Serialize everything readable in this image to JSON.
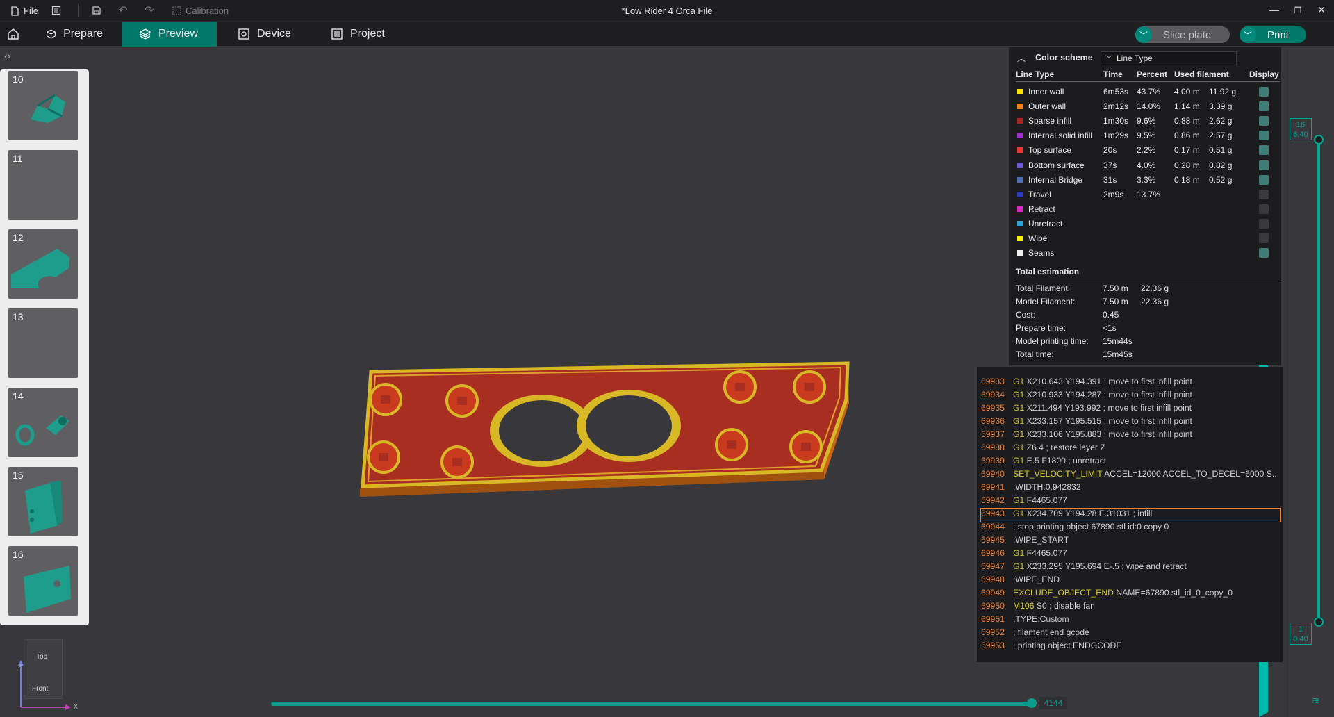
{
  "titlebar": {
    "file_label": "File",
    "calibration_label": "Calibration",
    "window_title": "*Low Rider 4 Orca File"
  },
  "nav": {
    "tabs": [
      {
        "label": "Prepare",
        "icon": "cube-icon"
      },
      {
        "label": "Preview",
        "icon": "layers-icon"
      },
      {
        "label": "Device",
        "icon": "device-icon"
      },
      {
        "label": "Project",
        "icon": "project-icon"
      }
    ],
    "slice_label": "Slice plate",
    "print_label": "Print"
  },
  "plates": [
    {
      "num": "10"
    },
    {
      "num": "11"
    },
    {
      "num": "12"
    },
    {
      "num": "13"
    },
    {
      "num": "14"
    },
    {
      "num": "15"
    },
    {
      "num": "16"
    }
  ],
  "gizmo": {
    "top": "Top",
    "front": "Front",
    "z": "Z",
    "x": "X"
  },
  "legend": {
    "title": "Color scheme",
    "scheme": "Line Type",
    "headers": {
      "type": "Line Type",
      "time": "Time",
      "percent": "Percent",
      "used": "Used filament",
      "display": "Display"
    },
    "rows": [
      {
        "name": "Inner wall",
        "color": "#ffe600",
        "time": "6m53s",
        "percent": "43.7%",
        "m": "4.00 m",
        "g": "11.92 g",
        "on": true
      },
      {
        "name": "Outer wall",
        "color": "#ff7f00",
        "time": "2m12s",
        "percent": "14.0%",
        "m": "1.14 m",
        "g": "3.39 g",
        "on": true
      },
      {
        "name": "Sparse infill",
        "color": "#b0231f",
        "time": "1m30s",
        "percent": "9.6%",
        "m": "0.88 m",
        "g": "2.62 g",
        "on": true
      },
      {
        "name": "Internal solid infill",
        "color": "#9933cc",
        "time": "1m29s",
        "percent": "9.5%",
        "m": "0.86 m",
        "g": "2.57 g",
        "on": true
      },
      {
        "name": "Top surface",
        "color": "#e43a2f",
        "time": "20s",
        "percent": "2.2%",
        "m": "0.17 m",
        "g": "0.51 g",
        "on": true
      },
      {
        "name": "Bottom surface",
        "color": "#6b58d6",
        "time": "37s",
        "percent": "4.0%",
        "m": "0.28 m",
        "g": "0.82 g",
        "on": true
      },
      {
        "name": "Internal Bridge",
        "color": "#4d6fb8",
        "time": "31s",
        "percent": "3.3%",
        "m": "0.18 m",
        "g": "0.52 g",
        "on": true
      },
      {
        "name": "Travel",
        "color": "#2b3ebf",
        "time": "2m9s",
        "percent": "13.7%",
        "m": "",
        "g": "",
        "on": false
      },
      {
        "name": "Retract",
        "color": "#d926d0",
        "time": "",
        "percent": "",
        "m": "",
        "g": "",
        "on": false
      },
      {
        "name": "Unretract",
        "color": "#29a6d9",
        "time": "",
        "percent": "",
        "m": "",
        "g": "",
        "on": false
      },
      {
        "name": "Wipe",
        "color": "#f2f200",
        "time": "",
        "percent": "",
        "m": "",
        "g": "",
        "on": false
      },
      {
        "name": "Seams",
        "color": "#f0f0f0",
        "time": "",
        "percent": "",
        "m": "",
        "g": "",
        "on": true
      }
    ],
    "total_title": "Total estimation",
    "totals": [
      {
        "label": "Total Filament:",
        "a": "7.50 m",
        "b": "22.36 g"
      },
      {
        "label": "Model Filament:",
        "a": "7.50 m",
        "b": "22.36 g"
      },
      {
        "label": "Cost:",
        "a": "0.45",
        "b": ""
      },
      {
        "label": "Prepare time:",
        "a": "<1s",
        "b": ""
      },
      {
        "label": "Model printing time:",
        "a": "15m44s",
        "b": ""
      },
      {
        "label": "Total time:",
        "a": "15m45s",
        "b": ""
      }
    ]
  },
  "gcode": [
    {
      "n": "69933",
      "c": "G1",
      "r": " X210.643 Y194.391 ; move to first infill point"
    },
    {
      "n": "69934",
      "c": "G1",
      "r": " X210.933 Y194.287 ; move to first infill point"
    },
    {
      "n": "69935",
      "c": "G1",
      "r": " X211.494 Y193.992 ; move to first infill point"
    },
    {
      "n": "69936",
      "c": "G1",
      "r": " X233.157 Y195.515 ; move to first infill point"
    },
    {
      "n": "69937",
      "c": "G1",
      "r": " X233.106 Y195.883 ; move to first infill point"
    },
    {
      "n": "69938",
      "c": "G1",
      "r": " Z6.4 ; restore layer Z"
    },
    {
      "n": "69939",
      "c": "G1",
      "r": " E.5 F1800 ; unretract"
    },
    {
      "n": "69940",
      "c": "SET_VELOCITY_LIMIT",
      "r": " ACCEL=12000 ACCEL_TO_DECEL=6000 S..."
    },
    {
      "n": "69941",
      "c": "",
      "r": ";WIDTH:0.942832"
    },
    {
      "n": "69942",
      "c": "G1",
      "r": " F4465.077"
    },
    {
      "n": "69943",
      "c": "G1",
      "r": " X234.709 Y194.28 E.31031 ; infill"
    },
    {
      "n": "69944",
      "c": "",
      "r": "; stop printing object 67890.stl id:0 copy 0"
    },
    {
      "n": "69945",
      "c": "",
      "r": ";WIPE_START"
    },
    {
      "n": "69946",
      "c": "G1",
      "r": " F4465.077"
    },
    {
      "n": "69947",
      "c": "G1",
      "r": " X233.295 Y195.694 E-.5 ; wipe and retract"
    },
    {
      "n": "69948",
      "c": "",
      "r": ";WIPE_END"
    },
    {
      "n": "69949",
      "c": "EXCLUDE_OBJECT_END",
      "r": " NAME=67890.stl_id_0_copy_0"
    },
    {
      "n": "69950",
      "c": "M106",
      "r": " S0 ; disable fan"
    },
    {
      "n": "69951",
      "c": "",
      "r": ";TYPE:Custom"
    },
    {
      "n": "69952",
      "c": "",
      "r": "; filament end gcode"
    },
    {
      "n": "69953",
      "c": "",
      "r": "; printing object ENDGCODE"
    }
  ],
  "gcode_highlight_index": 10,
  "layers": {
    "top_layer": "16",
    "top_height": "6.40",
    "bottom_layer": "1",
    "bottom_height": "0.40"
  },
  "move_slider": {
    "value": "4144"
  }
}
